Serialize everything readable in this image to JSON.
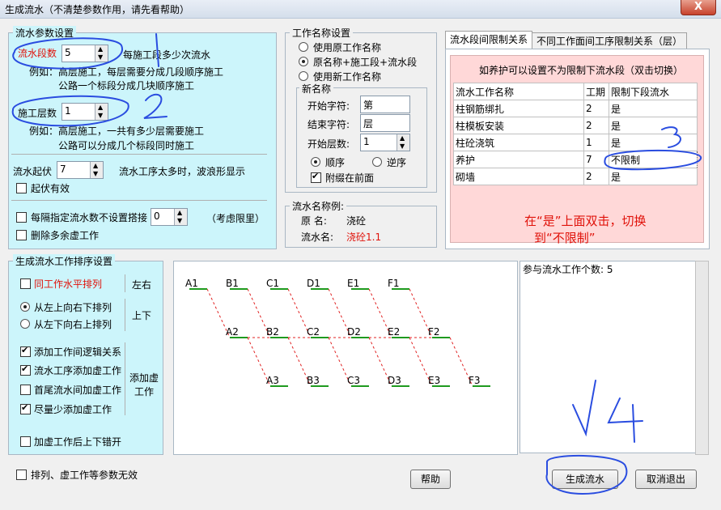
{
  "window": {
    "title": "生成流水（不清楚参数作用，请先看帮助）",
    "close_label": "X"
  },
  "params": {
    "group_title": "流水参数设置",
    "segments_label": "流水段数",
    "segments_value": "5",
    "segments_desc": "每施工段多少次流水",
    "segments_example1": "例如：高层施工，每层需要分成几段顺序施工",
    "segments_example2": "公路一个标段分成几块顺序施工",
    "floors_label": "施工层数",
    "floors_value": "1",
    "floors_example1": "例如：高层施工，一共有多少层需要施工",
    "floors_example2": "公路可以分成几个标段同时施工",
    "wave_label": "流水起伏",
    "wave_value": "7",
    "wave_desc": "流水工序太多时，波浪形显示",
    "wave_valid": "起伏有效",
    "interval_label": "每隔指定流水数不设置搭接",
    "interval_value": "0",
    "interval_note": "（考虑限里）",
    "delete_dummy": "删除多余虚工作"
  },
  "naming": {
    "group_title": "工作名称设置",
    "opt_original": "使用原工作名称",
    "opt_combined": "原名称+施工段+流水段",
    "opt_new": "使用新工作名称",
    "new_group": "新名称",
    "start_char_label": "开始字符:",
    "start_char_value": "第",
    "end_char_label": "结束字符:",
    "end_char_value": "层",
    "start_floor_label": "开始层数:",
    "start_floor_value": "1",
    "order_asc": "顺序",
    "order_desc": "逆序",
    "attach_front": "附缀在前面"
  },
  "example": {
    "group_title": "流水名称例:",
    "orig_label": "原  名:",
    "orig_value": "浇砼",
    "flow_label": "流水名:",
    "flow_value": "浇砼1.1"
  },
  "tabs": {
    "tab1": "流水段间限制关系",
    "tab2": "不同工作面间工序限制关系（层）"
  },
  "limit": {
    "hint": "如养护可以设置不为限制下流水段（双击切换）",
    "columns": [
      "流水工作名称",
      "工期",
      "限制下段流水"
    ],
    "rows": [
      [
        "柱钢筋绑扎",
        "2",
        "是"
      ],
      [
        "柱模板安装",
        "2",
        "是"
      ],
      [
        "柱砼浇筑",
        "1",
        "是"
      ],
      [
        "养护",
        "7",
        "不限制"
      ],
      [
        "砌墙",
        "2",
        "是"
      ]
    ],
    "annotation1": "在“是”上面双击，切换",
    "annotation2": "到“不限制”"
  },
  "sort": {
    "group_title": "生成流水工作排序设置",
    "same_horizontal": "同工作水平排列",
    "left_right": "左右",
    "left_top_down": "从左上向右下排列",
    "left_down_top": "从左下向右上排列",
    "up_down": "上下",
    "add_logic": "添加工作间逻辑关系",
    "add_dummy_seq": "流水工序添加虚工作",
    "add_dummy_ends": "首尾流水间加虚工作",
    "min_dummy": "尽量少添加虚工作",
    "add_dummy_side": "添加虚工作",
    "stagger": "加虚工作后上下错开"
  },
  "preview": {
    "row1": [
      "A1",
      "B1",
      "C1",
      "D1",
      "E1",
      "F1"
    ],
    "row2": [
      "A2",
      "B2",
      "C2",
      "D2",
      "E2",
      "F2"
    ],
    "row3": [
      "A3",
      "B3",
      "C3",
      "D3",
      "E3",
      "F3"
    ]
  },
  "info": {
    "count_label": "参与流水工作个数: 5"
  },
  "footer": {
    "invalid": "排列、虚工作等参数无效",
    "help": "帮助",
    "generate": "生成流水",
    "cancel": "取消退出"
  },
  "colors": {
    "cyan_bg": "#ccf5fb",
    "annotation_red": "#e0120a",
    "pen_blue": "#2a4de0",
    "line_green": "#1f9a1f",
    "dash_red": "#e02020"
  }
}
